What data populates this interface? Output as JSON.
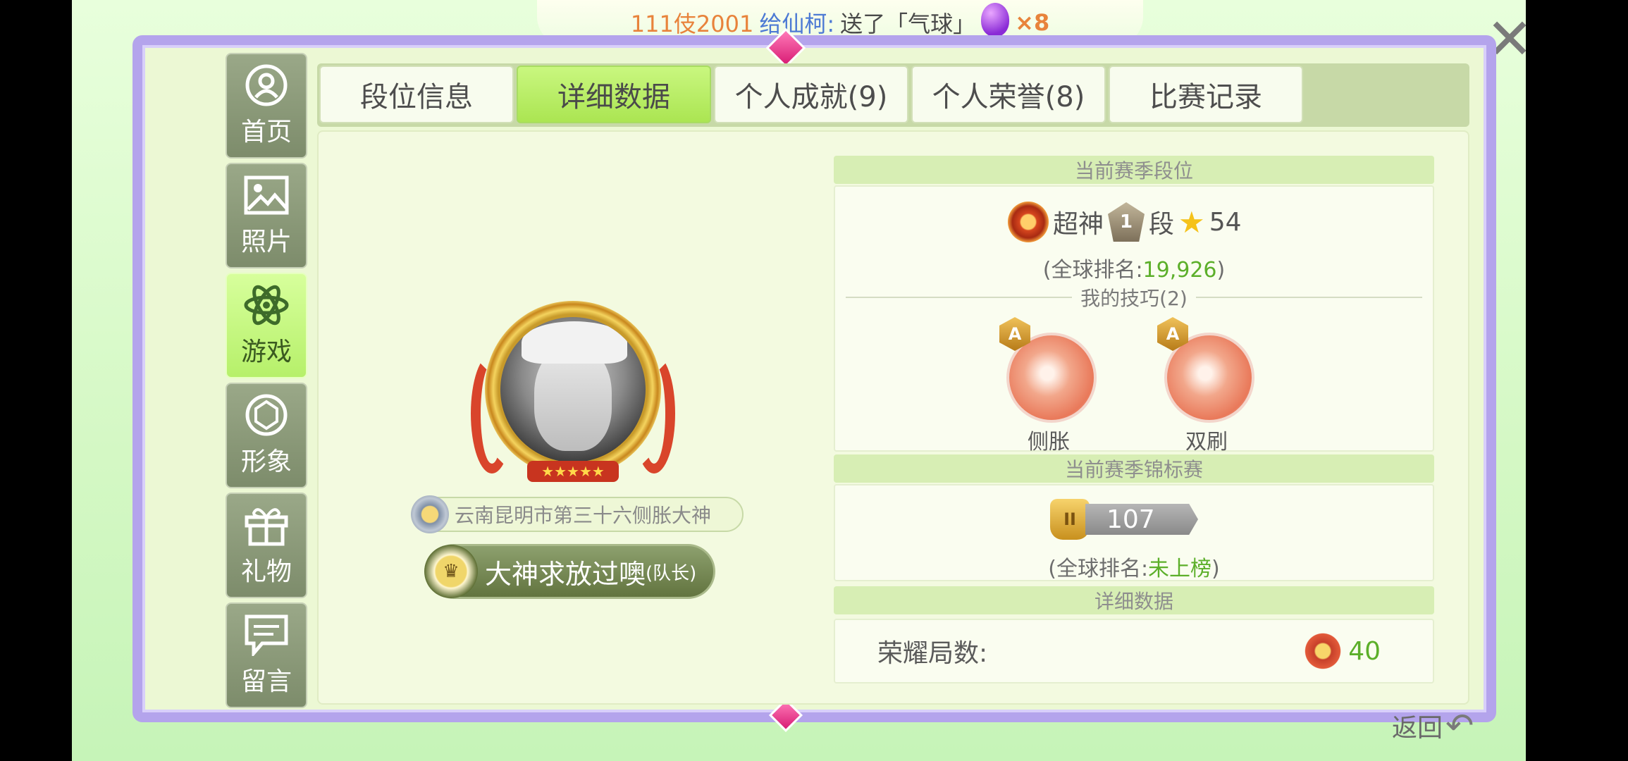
{
  "broadcast": {
    "sender": "111伎2001",
    "middle": "给仙柯:",
    "action": "送了「气球」",
    "count": "×8"
  },
  "sidebar": {
    "items": [
      {
        "label": "首页",
        "icon": "user-circle-icon",
        "active": false
      },
      {
        "label": "照片",
        "icon": "photo-icon",
        "active": false
      },
      {
        "label": "游戏",
        "icon": "atom-icon",
        "active": true
      },
      {
        "label": "形象",
        "icon": "diamond-ring-icon",
        "active": false
      },
      {
        "label": "礼物",
        "icon": "gift-icon",
        "active": false
      },
      {
        "label": "留言",
        "icon": "message-icon",
        "active": false
      }
    ]
  },
  "tabs": [
    {
      "label": "段位信息",
      "active": false
    },
    {
      "label": "详细数据",
      "active": true
    },
    {
      "label": "个人成就(9)",
      "active": false
    },
    {
      "label": "个人荣誉(8)",
      "active": false
    },
    {
      "label": "比赛记录",
      "active": false
    }
  ],
  "profile": {
    "title": "云南昆明市第三十六侧胀大神",
    "team_name": "大神求放过噢",
    "team_role": "(队长)"
  },
  "season_rank": {
    "heading": "当前赛季段位",
    "tier": "超神",
    "tier_level": "1",
    "tier_suffix": "段",
    "stars": "54",
    "global_rank_prefix": "(全球排名:",
    "global_rank_value": "19,926",
    "global_rank_suffix": ")"
  },
  "skills": {
    "heading": "我的技巧(2)",
    "items": [
      {
        "grade": "A",
        "name": "侧胀"
      },
      {
        "grade": "A",
        "name": "双刷"
      }
    ]
  },
  "championship": {
    "heading": "当前赛季锦标赛",
    "trophy_level": "II",
    "score": "107",
    "global_rank_prefix": "(全球排名:",
    "global_rank_value": "未上榜",
    "global_rank_suffix": ")"
  },
  "details": {
    "heading": "详细数据",
    "rows": [
      {
        "label": "荣耀局数:",
        "value": "40"
      }
    ]
  },
  "footer": {
    "back_label": "返回"
  },
  "colors": {
    "accent_green": "#5caf2a",
    "frame_purple": "#b4a4ec",
    "active_tab": "#b6f06a"
  }
}
